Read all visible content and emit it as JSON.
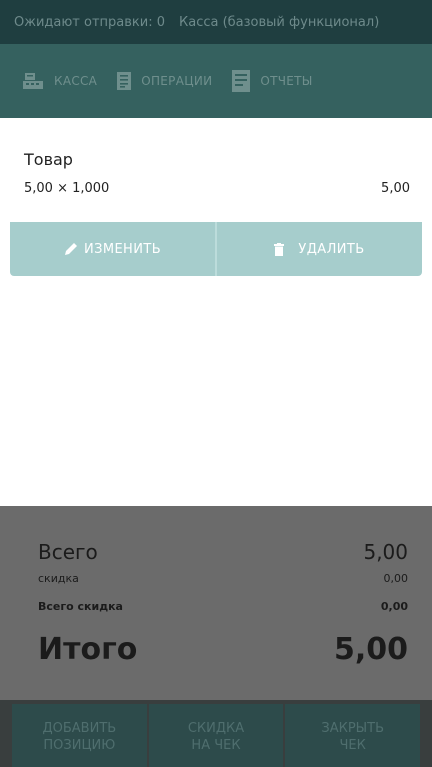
{
  "status": {
    "pending_label": "Ожидают отправки: 0",
    "mode_label": "Касса (базовый функционал)"
  },
  "nav": {
    "tabs": [
      {
        "label": "КАССА",
        "icon": "cash-register-icon"
      },
      {
        "label": "ОПЕРАЦИИ",
        "icon": "document-list-icon"
      },
      {
        "label": "ОТЧЕТЫ",
        "icon": "report-icon"
      }
    ]
  },
  "item": {
    "name": "Товар",
    "qty_price": "5,00 × 1,000",
    "sum": "5,00"
  },
  "actions": {
    "edit_label": "ИЗМЕНИТЬ",
    "delete_label": "УДАЛИТЬ"
  },
  "totals": {
    "total_label": "Всего",
    "total_value": "5,00",
    "discount_label": "скидка",
    "discount_value": "0,00",
    "total_discount_label": "Всего скидка",
    "total_discount_value": "0,00",
    "grand_label": "Итого",
    "grand_value": "5,00"
  },
  "bottom": {
    "add_position": "ДОБАВИТЬ\nПОЗИЦИЮ",
    "check_discount": "СКИДКА\nНА ЧЕК",
    "close_check": "ЗАКРЫТЬ\nЧЕК"
  },
  "colors": {
    "header": "#35615f",
    "status": "#1f3e40",
    "action_bar": "#a6cdcc",
    "totals_bg": "#6b6b6b",
    "bottom_btn": "#2d4b4b"
  }
}
